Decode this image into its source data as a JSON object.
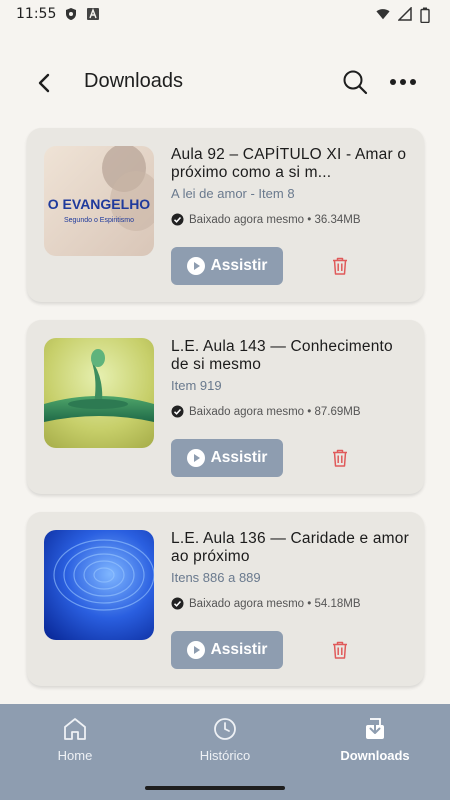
{
  "status_bar": {
    "time": "11:55"
  },
  "header": {
    "title": "Downloads"
  },
  "downloads": [
    {
      "title": "Aula 92 – CAPÍTULO XI - Amar o próximo como a si m...",
      "subtitle": "A lei de amor - Item 8",
      "status": "Baixado agora mesmo • 36.34MB",
      "play_label": "Assistir",
      "thumb_title": "O EVANGELHO",
      "thumb_subtitle": "Segundo o Espiritismo"
    },
    {
      "title": "L.E. Aula 143 — Conhecimento de si mesmo",
      "subtitle": "Item 919",
      "status": "Baixado agora mesmo • 87.69MB",
      "play_label": "Assistir"
    },
    {
      "title": "L.E. Aula 136 — Caridade e amor ao próximo",
      "subtitle": "Itens 886 a 889",
      "status": "Baixado agora mesmo • 54.18MB",
      "play_label": "Assistir"
    }
  ],
  "bottom_nav": {
    "items": [
      {
        "label": "Home",
        "icon": "home-icon"
      },
      {
        "label": "Histórico",
        "icon": "clock-icon"
      },
      {
        "label": "Downloads",
        "icon": "download-icon",
        "active": true
      }
    ]
  },
  "colors": {
    "background": "#f6f4f0",
    "card": "#e9e7e2",
    "accent": "#8e9db0",
    "subtitle": "#6a7a8e",
    "delete": "#e05a5a"
  }
}
